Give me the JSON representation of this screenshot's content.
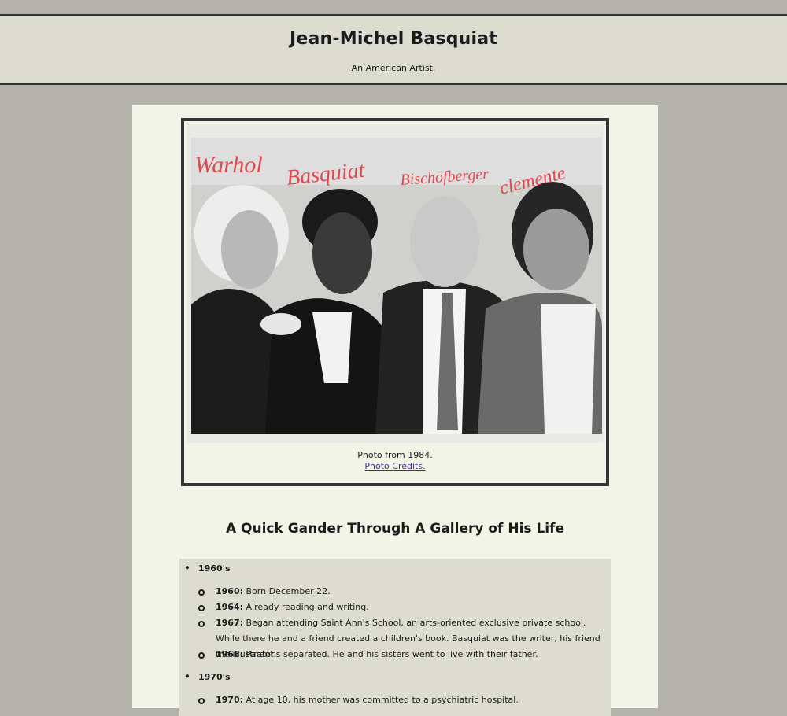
{
  "header": {
    "title": "Jean-Michel Basquiat",
    "subtitle": "An American Artist."
  },
  "figure": {
    "photo_labels": [
      "Warhol",
      "Basquiat",
      "Bischofberger",
      "clemente"
    ],
    "caption": "Photo from 1984.",
    "credits_link": "Photo Credits."
  },
  "gallery": {
    "title": "A Quick Gander Through A Gallery of His Life",
    "decades": [
      {
        "label": "1960's",
        "events": [
          {
            "year": "1960:",
            "text": "Born December 22."
          },
          {
            "year": "1964:",
            "text": "Already reading and writing."
          },
          {
            "year": "1967:",
            "text": "Began attending Saint Ann's School, an arts-oriented exclusive private school. While there he and a friend created a children's book. Basquiat was the writer, his friend the illustrator."
          },
          {
            "year": "1968:",
            "text": "Parent's separated. He and his sisters went to live with their father."
          }
        ]
      },
      {
        "label": "1970's",
        "events": [
          {
            "year": "1970:",
            "text": "At age 10, his mother was committed to a psychiatric hospital."
          }
        ]
      }
    ]
  },
  "colors": {
    "page_bg": "#b3b3ab",
    "header_bg": "#dcdcd0",
    "content_bg": "#f3f4e8",
    "link": "#4b2a86",
    "annotation_red": "#e0474f"
  }
}
